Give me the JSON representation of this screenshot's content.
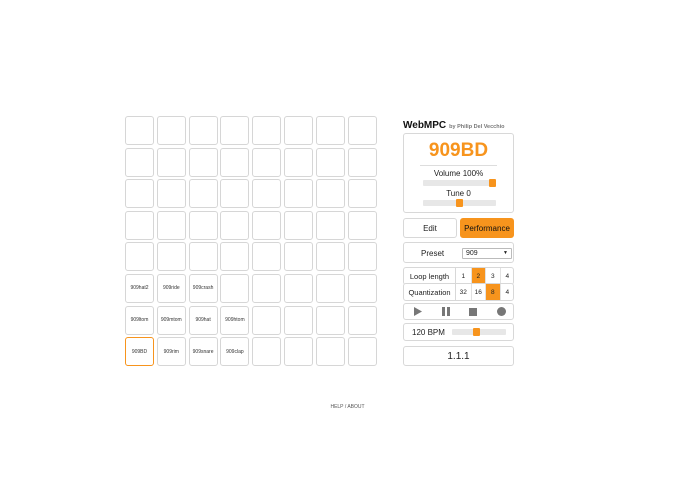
{
  "app": {
    "title": "WebMPC",
    "subtitle": "by Philip Del Vecchio"
  },
  "accent_color": "#f7941d",
  "pads": {
    "rows": [
      [
        "",
        "",
        "",
        "",
        "",
        "",
        "",
        ""
      ],
      [
        "",
        "",
        "",
        "",
        "",
        "",
        "",
        ""
      ],
      [
        "",
        "",
        "",
        "",
        "",
        "",
        "",
        ""
      ],
      [
        "",
        "",
        "",
        "",
        "",
        "",
        "",
        ""
      ],
      [
        "",
        "",
        "",
        "",
        "",
        "",
        "",
        ""
      ],
      [
        "909hat2",
        "909ride",
        "909crash",
        "",
        "",
        "",
        "",
        ""
      ],
      [
        "909ltom",
        "909mtom",
        "909hat",
        "909htom",
        "",
        "",
        "",
        ""
      ],
      [
        "909BD",
        "909rim",
        "909snare",
        "909clap",
        "",
        "",
        "",
        ""
      ]
    ],
    "active": "909BD"
  },
  "pad_panel": {
    "name": "909BD",
    "volume_label": "Volume 100%",
    "volume_value": 1.0,
    "tune_label": "Tune 0",
    "tune_value": 0.5
  },
  "modes": {
    "edit": "Edit",
    "performance": "Performance",
    "active": "performance"
  },
  "preset": {
    "label": "Preset",
    "value": "909"
  },
  "loop_length": {
    "label": "Loop length",
    "options": [
      "1",
      "2",
      "3",
      "4"
    ],
    "selected": "2"
  },
  "quantization": {
    "label": "Quantization",
    "options": [
      "32",
      "16",
      "8",
      "4"
    ],
    "selected": "8"
  },
  "transport": {
    "icons": [
      "play-icon",
      "pause-icon",
      "stop-icon",
      "record-icon"
    ]
  },
  "tempo": {
    "label": "120 BPM",
    "value": 120,
    "slider_value": 0.45
  },
  "position": {
    "counter": "1.1.1"
  },
  "footer": {
    "help": "HELP / ABOUT"
  }
}
